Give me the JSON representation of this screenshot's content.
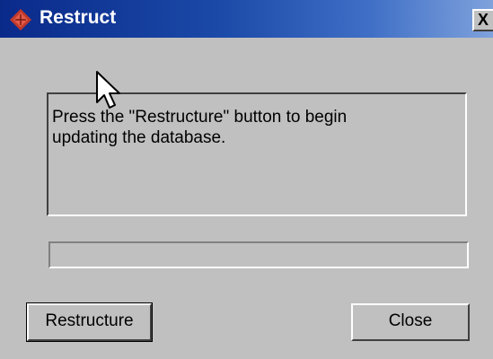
{
  "window": {
    "title": "Restruct",
    "close_glyph": "X"
  },
  "message": {
    "text": "Press the \"Restructure\" button to begin\nupdating the database."
  },
  "progress": {
    "value": 0
  },
  "buttons": {
    "restructure_label": "Restructure",
    "close_label": "Close"
  },
  "icons": {
    "app": "diamond-app-icon",
    "cursor": "mouse-pointer-icon"
  },
  "colors": {
    "titlebar_start": "#0a2a8a",
    "titlebar_end": "#7fa2dc",
    "dialog_bg": "#c0c0c0",
    "app_icon": "#c0392b"
  }
}
